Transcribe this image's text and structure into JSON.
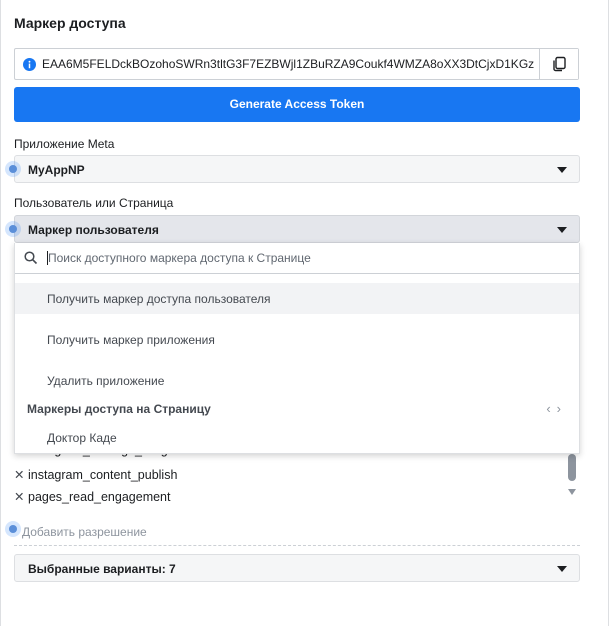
{
  "title": "Маркер доступа",
  "token": {
    "value": "EAA6M5FELDckBOzohoSWRn3tltG3F7EZBWjl1ZBuRZA9Coukf4WMZA8oXX3DtCjxD1KGz",
    "info_icon": "info-icon",
    "copy_icon": "copy-icon"
  },
  "generate_button": "Generate Access Token",
  "meta_app": {
    "label": "Приложение Meta",
    "value": "MyAppNP"
  },
  "user_or_page": {
    "label": "Пользователь или Страница",
    "value": "Маркер пользователя"
  },
  "dropdown": {
    "search_placeholder": "Поиск доступного маркера доступа к Странице",
    "items": [
      "Получить маркер доступа пользователя",
      "Получить маркер приложения",
      "Удалить приложение"
    ],
    "section_title": "Маркеры доступа на Страницу",
    "page_items": [
      "Доктор Каде"
    ],
    "nav_prev": "‹",
    "nav_next": "›"
  },
  "permissions": [
    "instagram_manage_insights",
    "instagram_content_publish",
    "pages_read_engagement"
  ],
  "add_permission": "Добавить разрешение",
  "selected": "Выбранные варианты: 7",
  "colors": {
    "primary": "#1877f2",
    "dot": "#5b8fd9"
  }
}
